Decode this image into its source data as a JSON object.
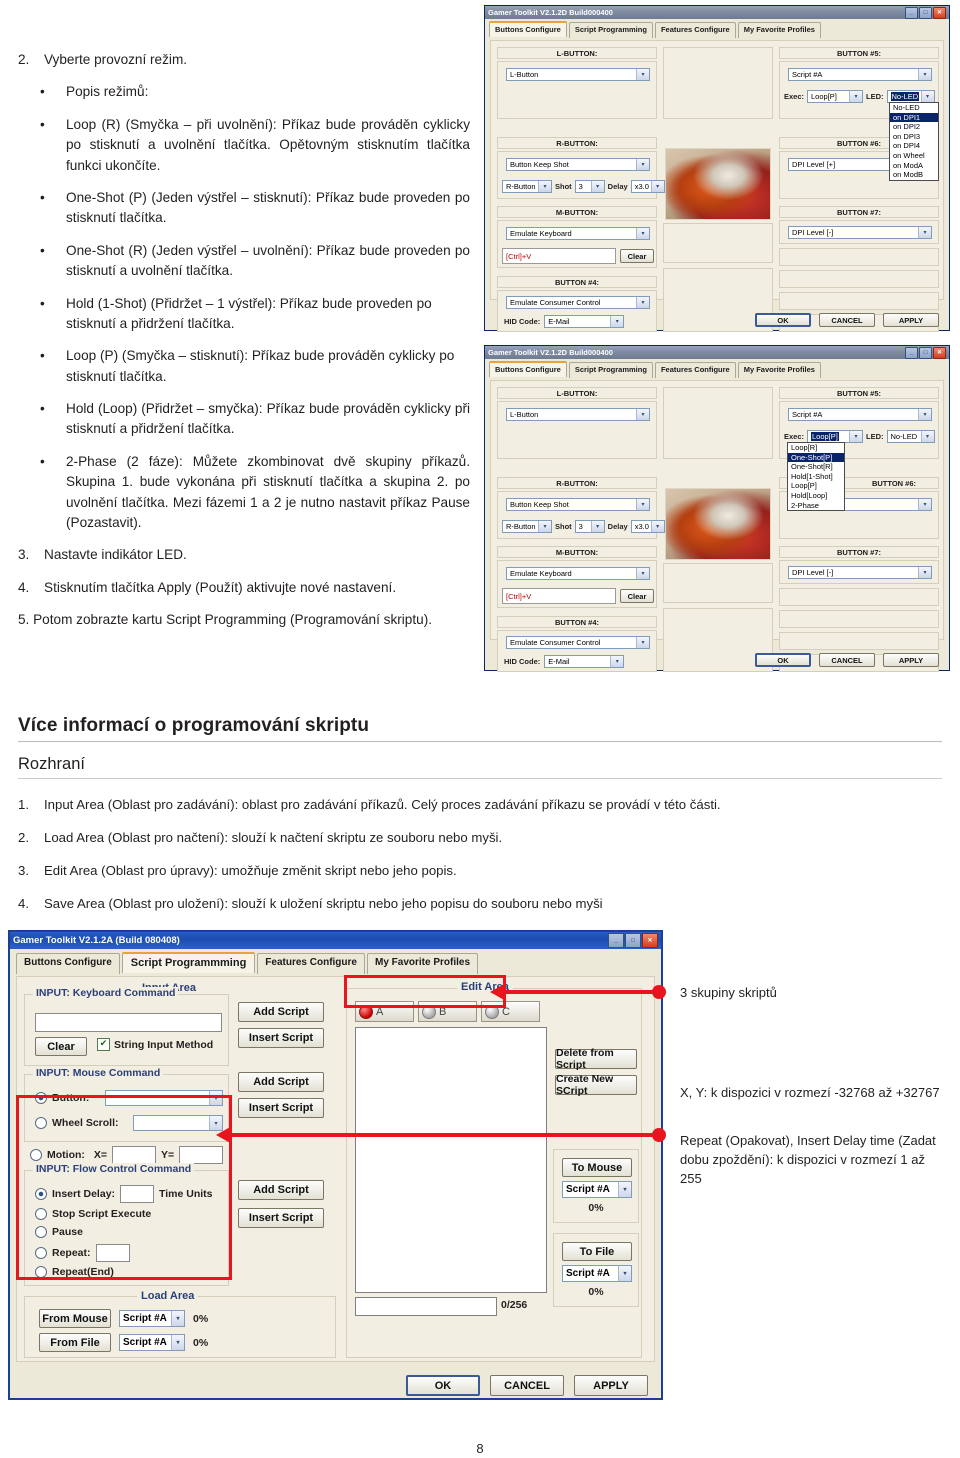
{
  "doc": {
    "item2_num": "2.",
    "item2_text": "Vyberte provozní režim.",
    "bullets": [
      "Popis režimů:",
      "Loop (R) (Smyčka – při uvolnění): Příkaz bude prováděn cyklicky po stisknutí a uvolnění tlačítka. Opětovným stisknutím tlačítka funkci ukončíte.",
      "One-Shot (P) (Jeden výstřel – stisknutí): Příkaz bude proveden po stisknutí tlačítka.",
      "One-Shot (R) (Jeden výstřel – uvolnění): Příkaz bude proveden po stisknutí a uvolnění tlačítka.",
      "Hold (1-Shot) (Přidržet – 1 výstřel): Příkaz bude proveden po stisknutí a přidržení tlačítka.",
      "Loop (P) (Smyčka – stisknutí): Příkaz bude prováděn cyklicky po stisknutí tlačítka.",
      "Hold (Loop) (Přidržet – smyčka): Příkaz bude prováděn cyklicky při stisknutí a přidržení tlačítka.",
      "2-Phase (2 fáze): Můžete zkombinovat dvě skupiny příkazů. Skupina 1. bude vykonána při stisknutí tlačítka a skupina 2. po uvolnění tlačítka. Mezi fázemi 1 a 2 je nutno nastavit příkaz Pause (Pozastavit)."
    ],
    "item3_num": "3.",
    "item3_text": "Nastavte indikátor LED.",
    "item4_num": "4.",
    "item4_text": "Stisknutím tlačítka Apply (Použít) aktivujte nové nastavení.",
    "item5_text": "5.  Potom zobrazte kartu Script Programming (Programování skriptu)."
  },
  "sections": {
    "h1": "Více informací o programování skriptu",
    "h2": "Rozhraní",
    "numbered": [
      {
        "n": "1.",
        "text": "Input Area (Oblast pro zadávání): oblast pro zadávání příkazů. Celý proces zadávání příkazu se provádí v této části."
      },
      {
        "n": "2.",
        "text": "Load Area (Oblast pro načtení): slouží k načtení skriptu ze souboru nebo myši."
      },
      {
        "n": "3.",
        "text": "Edit Area (Oblast pro úpravy): umožňuje změnit skript nebo jeho popis."
      },
      {
        "n": "4.",
        "text": "Save Area (Oblast pro uložení): slouží k uložení skriptu nebo jeho popisu do souboru nebo myši"
      }
    ]
  },
  "shot1": {
    "title": "Gamer Toolkit V2.1.2D Build000400",
    "tabs": [
      "Buttons Configure",
      "Script Programming",
      "Features Configure",
      "My Favorite Profiles"
    ],
    "left": {
      "lbutton_title": "L-BUTTON:",
      "lbutton_value": "L-Button",
      "rbutton_title": "R-BUTTON:",
      "rbutton_value": "Button Keep Shot",
      "rbutton_sub": "R-Button",
      "shot_label": "Shot",
      "shot_value": "3",
      "delay_label": "Delay",
      "delay_value": "x3.0",
      "mbutton_title": "M-BUTTON:",
      "mbutton_value": "Emulate Keyboard",
      "keys_value": "[Ctrl]+V",
      "clear_label": "Clear",
      "button4_title": "BUTTON #4:",
      "button4_value": "Emulate Consumer Control",
      "hid_label": "HID Code:",
      "hid_value": "E-Mail"
    },
    "right": {
      "button5_title": "BUTTON #5:",
      "button5_value": "Script #A",
      "exec_label": "Exec:",
      "exec_value": "Loop[P]",
      "led_label": "LED:",
      "led_value": "No-LED",
      "led_options": [
        "No-LED",
        "on DPI1",
        "on DPI2",
        "on DPI3",
        "on DPI4",
        "on Wheel",
        "on ModA",
        "on ModB"
      ],
      "led_selected": "on DPI1",
      "button6_title": "BUTTON #6:",
      "button6_value": "DPI Level [+]",
      "button7_title": "BUTTON #7:",
      "button7_value": "DPI Level [-]"
    },
    "footer": [
      "OK",
      "CANCEL",
      "APPLY"
    ]
  },
  "shot2": {
    "title": "Gamer Toolkit V2.1.2D Build000400",
    "tabs": [
      "Buttons Configure",
      "Script Programming",
      "Features Configure",
      "My Favorite Profiles"
    ],
    "left": {
      "lbutton_title": "L-BUTTON:",
      "lbutton_value": "L-Button",
      "rbutton_title": "R-BUTTON:",
      "rbutton_value": "Button Keep Shot",
      "rbutton_sub": "R-Button",
      "shot_label": "Shot",
      "shot_value": "3",
      "delay_label": "Delay",
      "delay_value": "x3.0",
      "mbutton_title": "M-BUTTON:",
      "mbutton_value": "Emulate Keyboard",
      "keys_value": "[Ctrl]+V",
      "clear_label": "Clear",
      "button4_title": "BUTTON #4:",
      "button4_value": "Emulate Consumer Control",
      "hid_label": "HID Code:",
      "hid_value": "E-Mail"
    },
    "right": {
      "button5_title": "BUTTON #5:",
      "button5_value": "Script #A",
      "exec_label": "Exec:",
      "exec_value": "Loop[P]",
      "led_label": "LED:",
      "led_value": "No-LED",
      "exec_options": [
        "Loop[R]",
        "One-Shot[P]",
        "One-Shot[R]",
        "Hold[1-Shot]",
        "Loop[P]",
        "Hold[Loop]",
        "2-Phase"
      ],
      "exec_selected": "One-Shot[P]",
      "button6_title": "BUTTON #6:",
      "button6_value": "DPI Level [+]",
      "button7_title": "BUTTON #7:",
      "button7_value": "DPI Level [-]"
    },
    "footer": [
      "OK",
      "CANCEL",
      "APPLY"
    ]
  },
  "shot3": {
    "title": "Gamer Toolkit V2.1.2A (Build 080408)",
    "tabs": [
      "Buttons Configure",
      "Script Programmming",
      "Features Configure",
      "My Favorite Profiles"
    ],
    "input_area_label": "Input Area",
    "kb_group": "INPUT: Keyboard Command",
    "kb_value": "",
    "clear_label": "Clear",
    "string_input_label": "String Input Method",
    "mouse_group": "INPUT: Mouse Command",
    "radio_button": "Button:",
    "radio_wheel": "Wheel Scroll:",
    "radio_motion": "Motion:",
    "x_label": "X=",
    "y_label": "Y=",
    "flow_group": "INPUT: Flow Control Command",
    "flow_items": [
      "Insert Delay:",
      "Stop Script Execute",
      "Pause",
      "Repeat:",
      "Repeat(End)"
    ],
    "time_units": "Time Units",
    "add_script": "Add Script",
    "insert_script": "Insert Script",
    "load_area_label": "Load Area",
    "from_mouse": "From Mouse",
    "from_file": "From File",
    "script_a": "Script #A",
    "pct0": "0%",
    "edit_area_label": "Edit Area",
    "script_slots": [
      "A",
      "B",
      "C"
    ],
    "delete_from_script": "Delete from Script",
    "create_new_script": "Create New SCript",
    "counter": "0/256",
    "to_mouse": "To Mouse",
    "to_file": "To File",
    "footer": [
      "OK",
      "CANCEL",
      "APPLY"
    ]
  },
  "callouts": {
    "c1": "3 skupiny skriptů",
    "c2": "X, Y: k dispozici v rozmezí -32768 až +32767",
    "c3": "Repeat (Opakovat), Insert Delay time (Zadat dobu zpoždění): k dispozici v rozmezí 1 až 255"
  },
  "page_number": "8",
  "colors": {
    "accent_red": "#e8141e",
    "title_blue": "#1b3f94"
  }
}
